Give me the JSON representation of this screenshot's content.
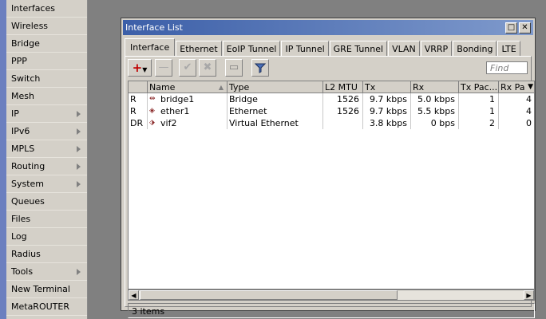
{
  "sidebar": {
    "items": [
      {
        "label": "Interfaces",
        "submenu": false
      },
      {
        "label": "Wireless",
        "submenu": false
      },
      {
        "label": "Bridge",
        "submenu": false
      },
      {
        "label": "PPP",
        "submenu": false
      },
      {
        "label": "Switch",
        "submenu": false
      },
      {
        "label": "Mesh",
        "submenu": false
      },
      {
        "label": "IP",
        "submenu": true
      },
      {
        "label": "IPv6",
        "submenu": true
      },
      {
        "label": "MPLS",
        "submenu": true
      },
      {
        "label": "Routing",
        "submenu": true
      },
      {
        "label": "System",
        "submenu": true
      },
      {
        "label": "Queues",
        "submenu": false
      },
      {
        "label": "Files",
        "submenu": false
      },
      {
        "label": "Log",
        "submenu": false
      },
      {
        "label": "Radius",
        "submenu": false
      },
      {
        "label": "Tools",
        "submenu": true
      },
      {
        "label": "New Terminal",
        "submenu": false
      },
      {
        "label": "MetaROUTER",
        "submenu": false
      }
    ]
  },
  "window": {
    "title": "Interface List",
    "tabs": [
      "Interface",
      "Ethernet",
      "EoIP Tunnel",
      "IP Tunnel",
      "GRE Tunnel",
      "VLAN",
      "VRRP",
      "Bonding",
      "LTE"
    ],
    "active_tab": "Interface",
    "find_placeholder": "Find",
    "toolbar_icons": [
      "add-icon",
      "remove-icon",
      "enable-icon",
      "disable-icon",
      "comment-icon",
      "filter-icon"
    ]
  },
  "table": {
    "columns": [
      "",
      "Name",
      "Type",
      "L2 MTU",
      "Tx",
      "Rx",
      "Tx Pac...",
      "Rx Pa"
    ],
    "rows": [
      {
        "flags": "R",
        "name": "bridge1",
        "icon": "bridge-icon",
        "type": "Bridge",
        "l2mtu": "1526",
        "tx": "9.7 kbps",
        "rx": "5.0 kbps",
        "txp": "1",
        "rxp": "4"
      },
      {
        "flags": "R",
        "name": "ether1",
        "icon": "ethernet-icon",
        "type": "Ethernet",
        "l2mtu": "1526",
        "tx": "9.7 kbps",
        "rx": "5.5 kbps",
        "txp": "1",
        "rxp": "4"
      },
      {
        "flags": "DR",
        "name": "vif2",
        "icon": "virtual-ethernet-icon",
        "type": "Virtual Ethernet",
        "l2mtu": "",
        "tx": "3.8 kbps",
        "rx": "0 bps",
        "txp": "2",
        "rxp": "0"
      }
    ]
  },
  "status": {
    "count": "3 items"
  },
  "colors": {
    "titlebar_start": "#3c5fa8",
    "titlebar_end": "#7f9acc",
    "add_icon": "#c00000",
    "side_band": "#6b7fbf"
  }
}
